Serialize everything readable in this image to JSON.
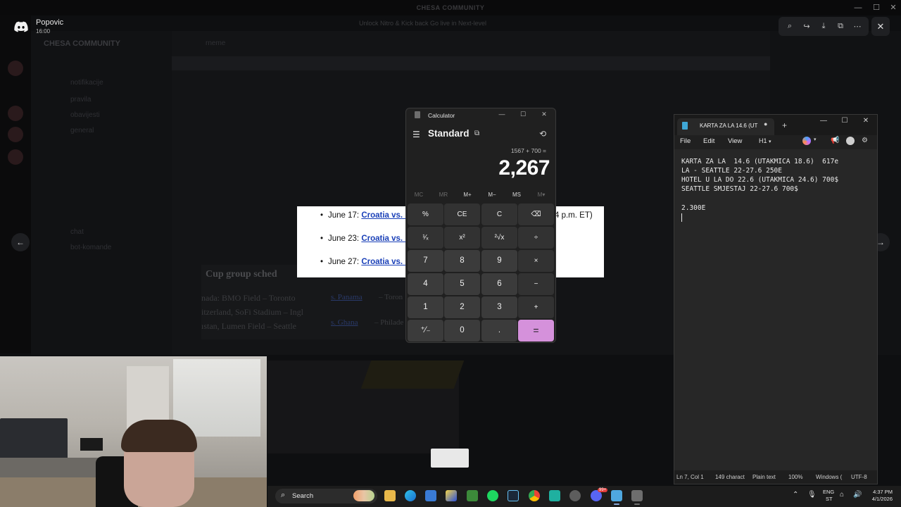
{
  "background_app": {
    "title": "CHESA COMMUNITY",
    "server_name": "CHESA COMMUNITY",
    "channel_header": "rneme",
    "announcement": "Unlock Nitro & Kick back Go live in Next-level",
    "channels": [
      "notifikacije",
      "pravila",
      "obavijesti",
      "general",
      "chat",
      "bot-komande"
    ]
  },
  "viewer": {
    "user": "Popovic",
    "time": "16:00",
    "tools": [
      "zoom-icon",
      "forward-icon",
      "download-icon",
      "open-external-icon",
      "more-icon"
    ],
    "close": "✕",
    "prev": "←",
    "next": "→"
  },
  "schedule": {
    "items": [
      {
        "date": "June 17:",
        "link": "Croatia vs. En",
        "tail": "4 p.m. ET)"
      },
      {
        "date": "June 23:",
        "link": "Croatia vs. Pa"
      },
      {
        "date": "June 27:",
        "link": "Croatia vs. Gh"
      }
    ],
    "bg_heading": "Cup group sched",
    "bg_rows": [
      "nada: BMO Field – Toronto",
      "itzerland, SoFi Stadium – Ingl",
      "ıstan, Lumen Field – Seattle"
    ],
    "bg_links": [
      "s. Panama",
      "s. Ghana"
    ],
    "bg_link_tails": [
      "– Toron",
      "– Philade"
    ]
  },
  "calculator": {
    "title": "Calculator",
    "mode": "Standard",
    "expression": "1567 + 700 =",
    "display": "2,267",
    "memory": [
      "MC",
      "MR",
      "M+",
      "M−",
      "MS",
      "M▾"
    ],
    "keys": [
      [
        "%",
        "CE",
        "C",
        "⌫"
      ],
      [
        "¹⁄ₓ",
        "x²",
        "²√x",
        "÷"
      ],
      [
        "7",
        "8",
        "9",
        "×"
      ],
      [
        "4",
        "5",
        "6",
        "−"
      ],
      [
        "1",
        "2",
        "3",
        "+"
      ],
      [
        "⁺⁄₋",
        "0",
        ".",
        "="
      ]
    ],
    "accent": "#d591db"
  },
  "notepad": {
    "tab_title": "KARTA ZA LA 14.6 (UT",
    "tab_modified": "●",
    "new_tab": "+",
    "menu": [
      "File",
      "Edit",
      "View"
    ],
    "heading": "H1",
    "lines": [
      "KARTA ZA LA  14.6 (UTAKMICA 18.6)  617e",
      "LA - SEATTLE 22-27.6 250E",
      "HOTEL U LA DO 22.6 (UTAKMICA 24.6) 700$",
      "SEATTLE SMJESTAJ 22-27.6 700$",
      "",
      "2.300E"
    ],
    "status": {
      "position": "Ln 7, Col 1",
      "chars": "149 charact",
      "format": "Plain text",
      "zoom": "100%",
      "line_ending": "Windows (",
      "encoding": "UTF-8"
    }
  },
  "taskbar": {
    "search_label": "Search",
    "apps": [
      "file-explorer",
      "edge",
      "store",
      "lens",
      "minecraft",
      "spotify",
      "steam",
      "chrome",
      "copilot-app",
      "settings",
      "discord",
      "notepad",
      "calculator"
    ],
    "discord_badge": "99+",
    "lang1": "ENG",
    "lang2": "ST",
    "time": "4:37 PM",
    "date": "4/1/2026"
  }
}
